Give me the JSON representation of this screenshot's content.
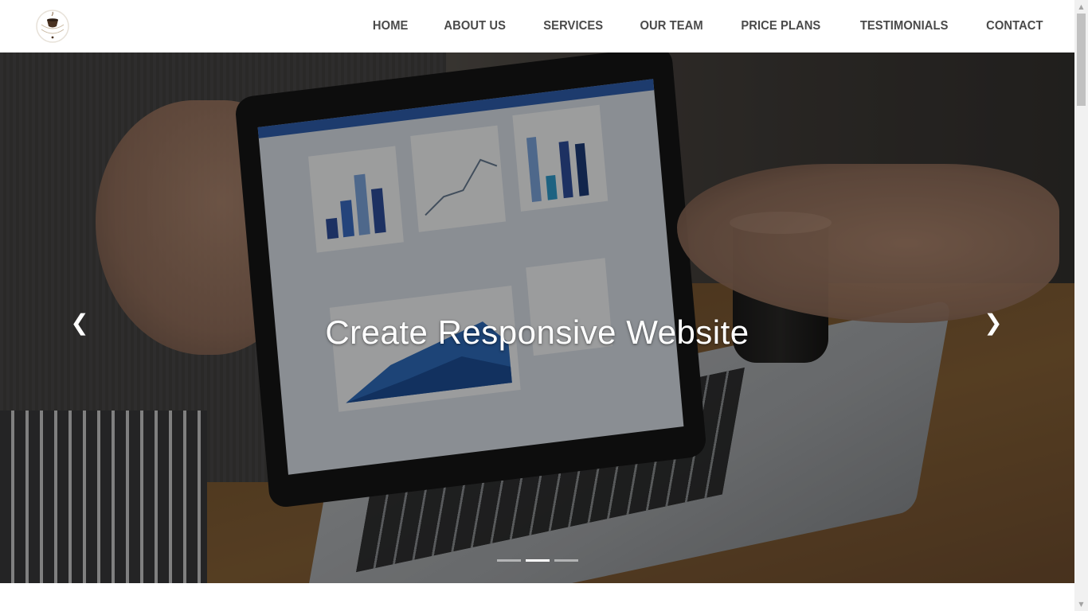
{
  "header": {
    "logo_icon": "coffee-cup-logo-icon",
    "nav": [
      {
        "label": "HOME"
      },
      {
        "label": "ABOUT US"
      },
      {
        "label": "SERVICES"
      },
      {
        "label": "OUR TEAM"
      },
      {
        "label": "PRICE PLANS"
      },
      {
        "label": "TESTIMONIALS"
      },
      {
        "label": "CONTACT"
      }
    ]
  },
  "hero": {
    "title": "Create Responsive Website",
    "prev_icon": "chevron-left-icon",
    "next_icon": "chevron-right-icon",
    "slides_total": 3,
    "active_slide": 2
  },
  "colors": {
    "nav_text": "#4a4a4a",
    "hero_title": "#ffffff",
    "header_bg": "#ffffff"
  }
}
